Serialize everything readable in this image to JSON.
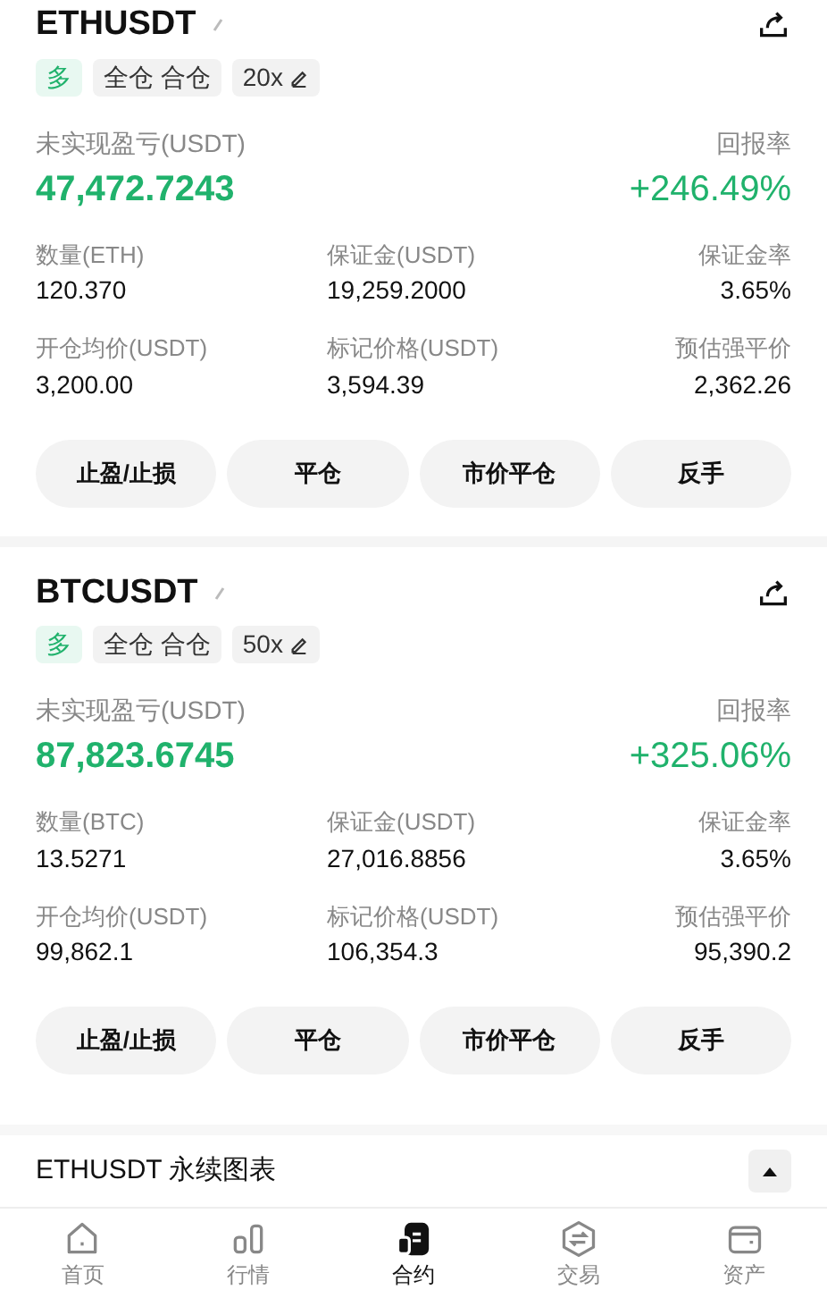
{
  "positions": [
    {
      "symbol": "ETHUSDT",
      "side": "多",
      "margin_mode": "全仓 合仓",
      "leverage": "20x",
      "pnl_label": "未实现盈亏(USDT)",
      "pnl": "47,472.7243",
      "roe_label": "回报率",
      "roe": "+246.49%",
      "metrics": [
        {
          "label": "数量(ETH)",
          "value": "120.370"
        },
        {
          "label": "保证金(USDT)",
          "value": "19,259.2000"
        },
        {
          "label": "保证金率",
          "value": "3.65%"
        },
        {
          "label": "开仓均价(USDT)",
          "value": "3,200.00"
        },
        {
          "label": "标记价格(USDT)",
          "value": "3,594.39"
        },
        {
          "label": "预估强平价",
          "value": "2,362.26"
        }
      ],
      "actions": [
        "止盈/止损",
        "平仓",
        "市价平仓",
        "反手"
      ]
    },
    {
      "symbol": "BTCUSDT",
      "side": "多",
      "margin_mode": "全仓 合仓",
      "leverage": "50x",
      "pnl_label": "未实现盈亏(USDT)",
      "pnl": "87,823.6745",
      "roe_label": "回报率",
      "roe": "+325.06%",
      "metrics": [
        {
          "label": "数量(BTC)",
          "value": "13.5271"
        },
        {
          "label": "保证金(USDT)",
          "value": "27,016.8856"
        },
        {
          "label": "保证金率",
          "value": "3.65%"
        },
        {
          "label": "开仓均价(USDT)",
          "value": "99,862.1"
        },
        {
          "label": "标记价格(USDT)",
          "value": "106,354.3"
        },
        {
          "label": "预估强平价",
          "value": "95,390.2"
        }
      ],
      "actions": [
        "止盈/止损",
        "平仓",
        "市价平仓",
        "反手"
      ]
    }
  ],
  "chart_bar": {
    "title": "ETHUSDT 永续图表"
  },
  "nav": [
    {
      "label": "首页",
      "kind": "home",
      "selected": false
    },
    {
      "label": "行情",
      "kind": "market",
      "selected": false
    },
    {
      "label": "合约",
      "kind": "futures",
      "selected": true
    },
    {
      "label": "交易",
      "kind": "trade",
      "selected": false
    },
    {
      "label": "资产",
      "kind": "assets",
      "selected": false
    }
  ]
}
